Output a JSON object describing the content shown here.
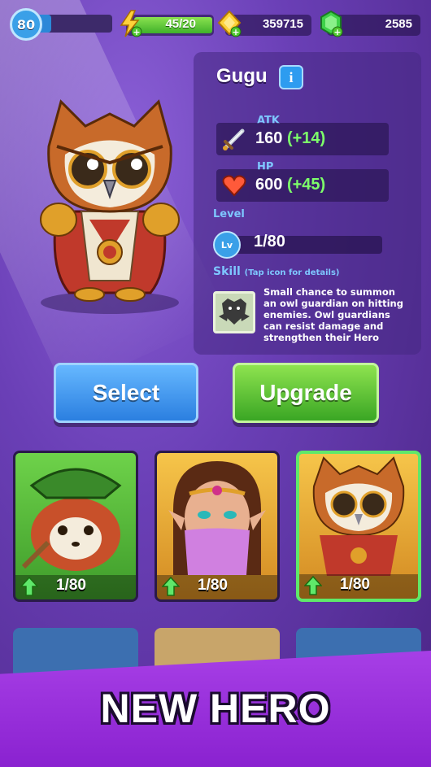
{
  "player": {
    "level": "80"
  },
  "resources": {
    "energy": "45/20",
    "gold": "359715",
    "gems": "2585"
  },
  "hero": {
    "name": "Gugu",
    "info_icon": "i",
    "atk_label": "ATK",
    "atk_value": "160",
    "atk_bonus": "(+14)",
    "hp_label": "HP",
    "hp_value": "600",
    "hp_bonus": "(+45)",
    "level_label": "Level",
    "level_icon": "Lv",
    "level_value": "1/80",
    "skill_label": "Skill",
    "skill_hint": "(Tap icon for details)",
    "skill_desc": "Small chance to summon an owl guardian on hitting enemies. Owl guardians can resist damage and strengthen their Hero"
  },
  "buttons": {
    "select": "Select",
    "upgrade": "Upgrade"
  },
  "cards": [
    {
      "level": "1/80"
    },
    {
      "level": "1/80"
    },
    {
      "level": "1/80"
    }
  ],
  "banner": {
    "text": "NEW HERO"
  }
}
